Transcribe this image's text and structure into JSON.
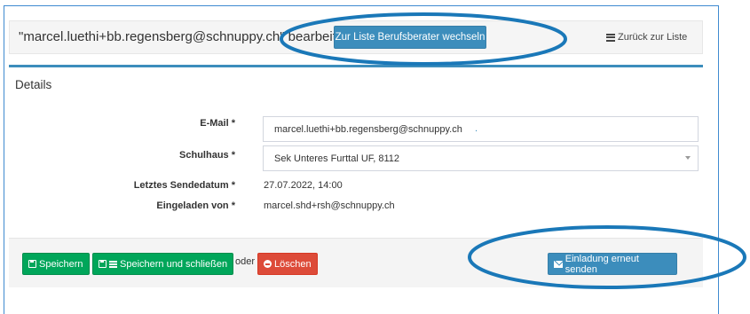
{
  "header": {
    "title": "\"marcel.luethi+bb.regensberg@schnuppy.ch\" bearbeiten",
    "switch_label": "Zur Liste Berufsberater wechseln",
    "back_label": "Zurück zur Liste"
  },
  "details": {
    "title": "Details",
    "fields": {
      "email_label": "E-Mail *",
      "email_value": "marcel.luethi+bb.regensberg@schnuppy.ch",
      "school_label": "Schulhaus *",
      "school_value": "Sek Unteres Furttal UF, 8112",
      "last_sent_label": "Letztes Sendedatum *",
      "last_sent_value": "27.07.2022, 14:00",
      "invited_by_label": "Eingeladen von *",
      "invited_by_value": "marcel.shd+rsh@schnuppy.ch"
    }
  },
  "footer": {
    "save_label": "Speichern",
    "save_close_label": "Speichern und schließen",
    "or_label": "oder",
    "delete_label": "Löschen",
    "resend_label": "Einladung erneut senden"
  },
  "colors": {
    "primary": "#3c8dbc",
    "success": "#00a65a",
    "danger": "#dd4b39",
    "annotation": "#1a78b8"
  },
  "icons": [
    "list-icon",
    "save-icon",
    "minus-circle-icon",
    "envelope-icon",
    "chevron-down-icon"
  ]
}
